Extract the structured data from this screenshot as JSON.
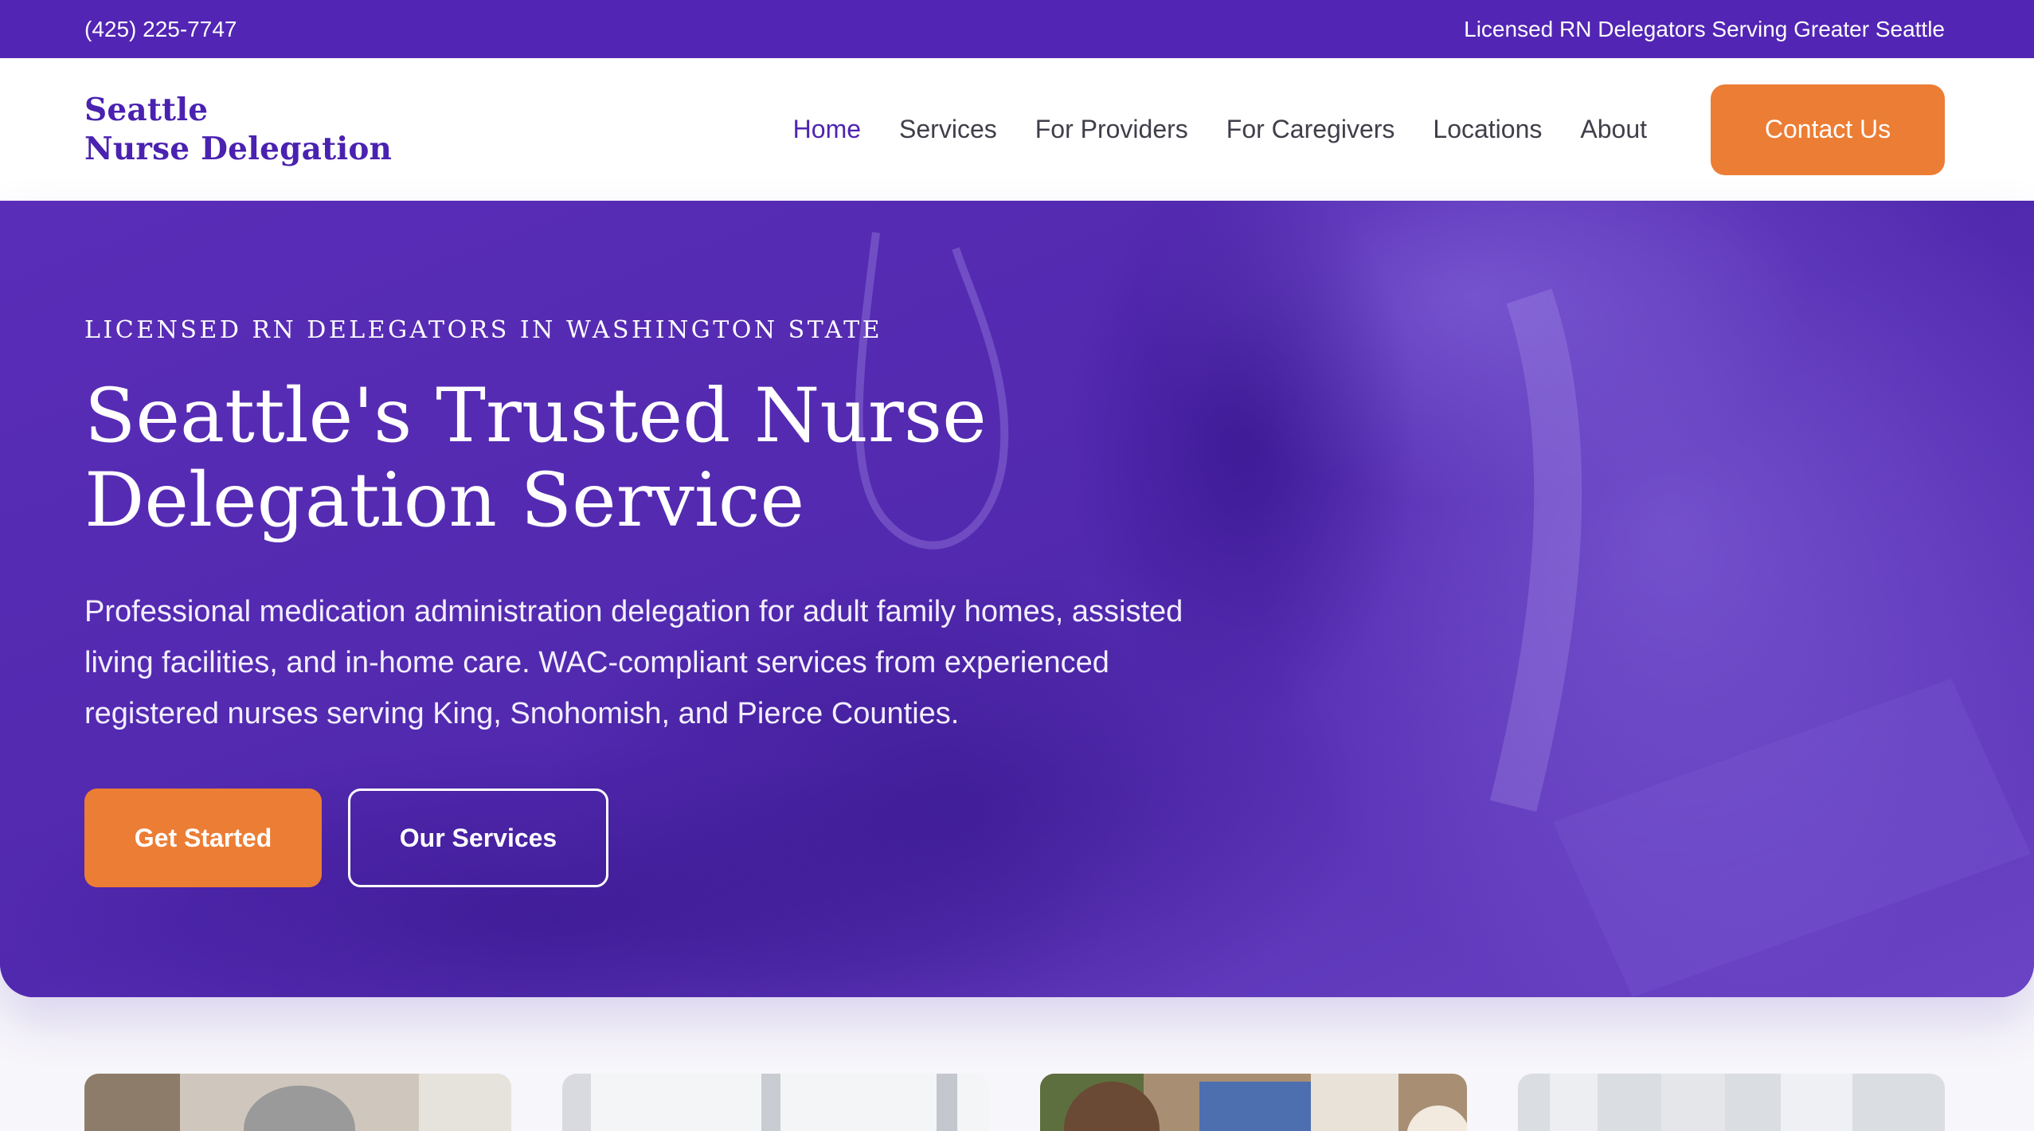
{
  "topbar": {
    "phone": "(425) 225-7747",
    "tagline": "Licensed RN Delegators Serving Greater Seattle"
  },
  "header": {
    "logo_line1": "Seattle",
    "logo_line2": "Nurse Delegation",
    "nav": [
      {
        "label": "Home",
        "active": true
      },
      {
        "label": "Services"
      },
      {
        "label": "For Providers"
      },
      {
        "label": "For Caregivers"
      },
      {
        "label": "Locations"
      },
      {
        "label": "About"
      }
    ],
    "contact_label": "Contact Us"
  },
  "hero": {
    "eyebrow": "LICENSED RN DELEGATORS IN WASHINGTON STATE",
    "headline_line1": "Seattle's Trusted Nurse",
    "headline_line2": "Delegation Service",
    "subtext": "Professional medication administration delegation for adult family homes, assisted living facilities, and in-home care. WAC-compliant services from experienced registered nurses serving King, Snohomish, and Pierce Counties.",
    "primary_button": "Get Started",
    "secondary_button": "Our Services"
  },
  "colors": {
    "brand_purple": "#5225b4",
    "accent_orange": "#ec7d34"
  }
}
